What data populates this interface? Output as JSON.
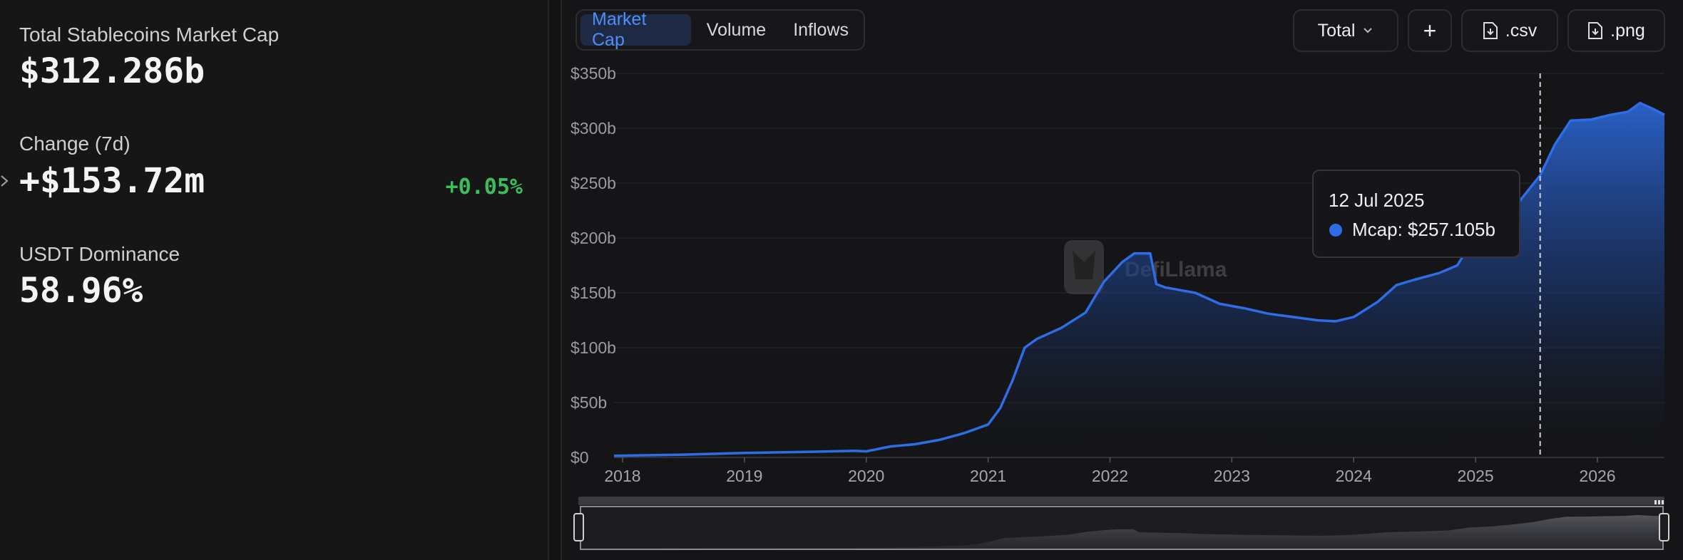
{
  "stats": {
    "total_label": "Total Stablecoins Market Cap",
    "total_value": "$312.286b",
    "change_label": "Change (7d)",
    "change_value": "+$153.72m",
    "change_pct": "+0.05%",
    "dominance_label": "USDT Dominance",
    "dominance_value": "58.96%"
  },
  "tabs": [
    {
      "label": "Market Cap",
      "active": true
    },
    {
      "label": "Volume",
      "active": false
    },
    {
      "label": "Inflows",
      "active": false
    }
  ],
  "toolbar": {
    "total_label": "Total",
    "add_label": "+",
    "csv_label": ".csv",
    "png_label": ".png"
  },
  "tooltip": {
    "date": "12 Jul 2025",
    "row": "Mcap: $257.105b"
  },
  "watermark": "DefiLlama",
  "colors": {
    "accent": "#2e6de6",
    "positive": "#3dbd5d",
    "tab_active_bg": "#1e2a44",
    "tab_active_text": "#4f8df5"
  },
  "icons": {
    "dropdown": "chevron-down-icon",
    "add": "plus-icon",
    "csv": "download-file-icon",
    "png": "download-file-icon",
    "expand": "chevron-right-icon"
  },
  "chart_data": {
    "type": "area",
    "ylabels": [
      "$0",
      "$50b",
      "$100b",
      "$150b",
      "$200b",
      "$250b",
      "$300b",
      "$350b"
    ],
    "xlabels": [
      "2018",
      "2019",
      "2020",
      "2021",
      "2022",
      "2023",
      "2024",
      "2025",
      "2026"
    ],
    "ylim": [
      0,
      350
    ],
    "xlim": [
      2017.93,
      2026.55
    ],
    "grid": true,
    "crosshair_x": 2025.53,
    "series": [
      {
        "points": [
          [
            2017.93,
            1.5
          ],
          [
            2018.5,
            2.5
          ],
          [
            2019.0,
            4
          ],
          [
            2019.5,
            5
          ],
          [
            2019.9,
            6
          ],
          [
            2020.0,
            5.5
          ],
          [
            2020.2,
            10
          ],
          [
            2020.4,
            12
          ],
          [
            2020.6,
            16
          ],
          [
            2020.8,
            22
          ],
          [
            2021.0,
            30
          ],
          [
            2021.1,
            45
          ],
          [
            2021.2,
            70
          ],
          [
            2021.3,
            100
          ],
          [
            2021.4,
            108
          ],
          [
            2021.6,
            118
          ],
          [
            2021.8,
            132
          ],
          [
            2021.95,
            160
          ],
          [
            2022.1,
            178
          ],
          [
            2022.2,
            186
          ],
          [
            2022.33,
            186
          ],
          [
            2022.38,
            158
          ],
          [
            2022.45,
            155
          ],
          [
            2022.7,
            150
          ],
          [
            2022.9,
            140
          ],
          [
            2023.1,
            136
          ],
          [
            2023.3,
            131
          ],
          [
            2023.5,
            128
          ],
          [
            2023.7,
            125
          ],
          [
            2023.85,
            124
          ],
          [
            2024.0,
            128
          ],
          [
            2024.2,
            142
          ],
          [
            2024.35,
            157
          ],
          [
            2024.5,
            162
          ],
          [
            2024.7,
            168
          ],
          [
            2024.85,
            175
          ],
          [
            2025.0,
            202
          ],
          [
            2025.2,
            215
          ],
          [
            2025.35,
            232
          ],
          [
            2025.53,
            257.105
          ],
          [
            2025.65,
            285
          ],
          [
            2025.78,
            307
          ],
          [
            2025.95,
            308
          ],
          [
            2026.1,
            312
          ],
          [
            2026.25,
            315
          ],
          [
            2026.35,
            323
          ],
          [
            2026.45,
            318
          ],
          [
            2026.55,
            312.286
          ]
        ]
      }
    ]
  }
}
